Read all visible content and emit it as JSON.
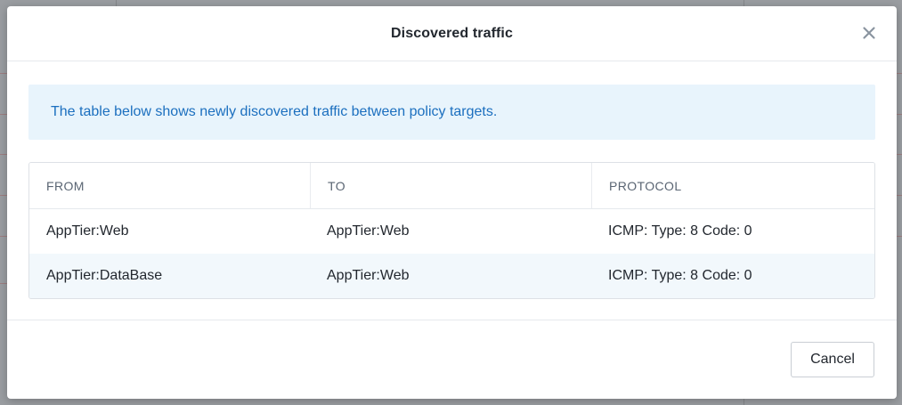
{
  "dialog": {
    "title": "Discovered traffic",
    "close_icon": "close-icon",
    "info_message": "The table below shows newly discovered traffic between policy targets."
  },
  "table": {
    "columns": [
      "FROM",
      "TO",
      "PROTOCOL"
    ],
    "rows": [
      [
        "AppTier:Web",
        "AppTier:Web",
        "ICMP: Type: 8 Code: 0"
      ],
      [
        "AppTier:DataBase",
        "AppTier:Web",
        "ICMP: Type: 8 Code: 0"
      ]
    ]
  },
  "footer": {
    "cancel_label": "Cancel"
  },
  "colors": {
    "info_banner_bg": "#e8f4fc",
    "info_text": "#1b6fbf",
    "alt_row_bg": "#f2f8fc"
  }
}
